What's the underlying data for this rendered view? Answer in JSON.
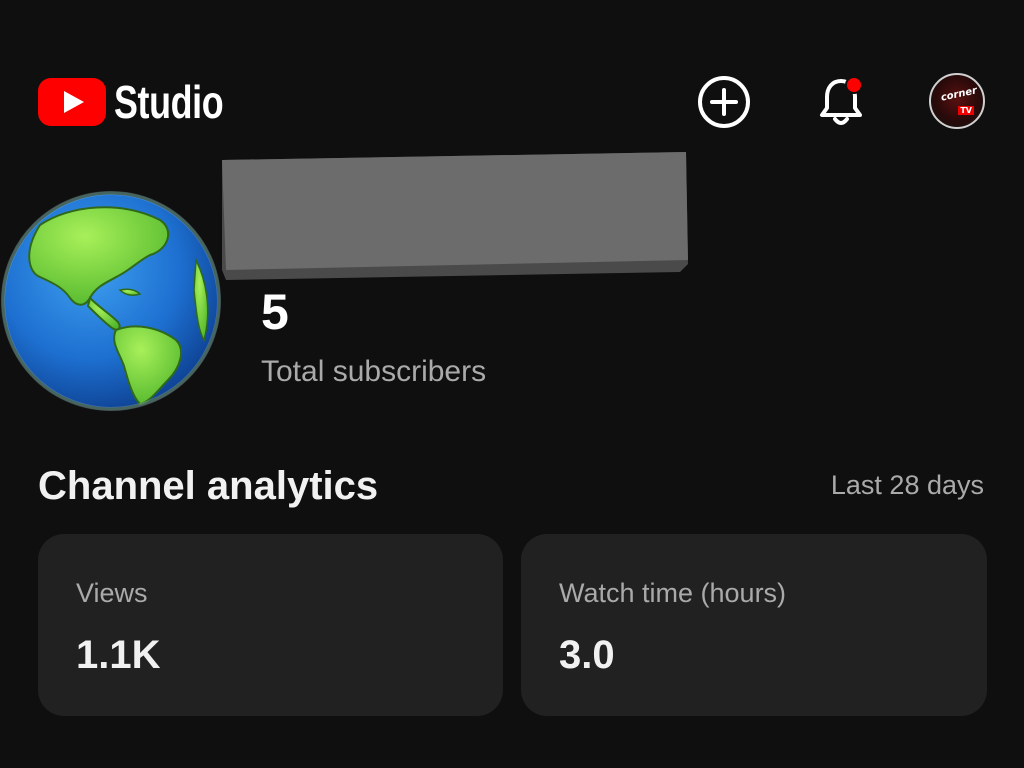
{
  "app": {
    "title": "Studio"
  },
  "header": {
    "create_icon": "plus-circle-icon",
    "notifications_icon": "bell-icon",
    "notification_dot_color": "#ff0000",
    "account_icon": "channel-avatar",
    "brand_color": "#ff0000"
  },
  "channel": {
    "subscriber_count": "5",
    "subscriber_label": "Total subscribers"
  },
  "analytics": {
    "title": "Channel analytics",
    "range": "Last 28 days",
    "cards": [
      {
        "label": "Views",
        "value": "1.1K"
      },
      {
        "label": "Watch time (hours)",
        "value": "3.0"
      }
    ]
  }
}
